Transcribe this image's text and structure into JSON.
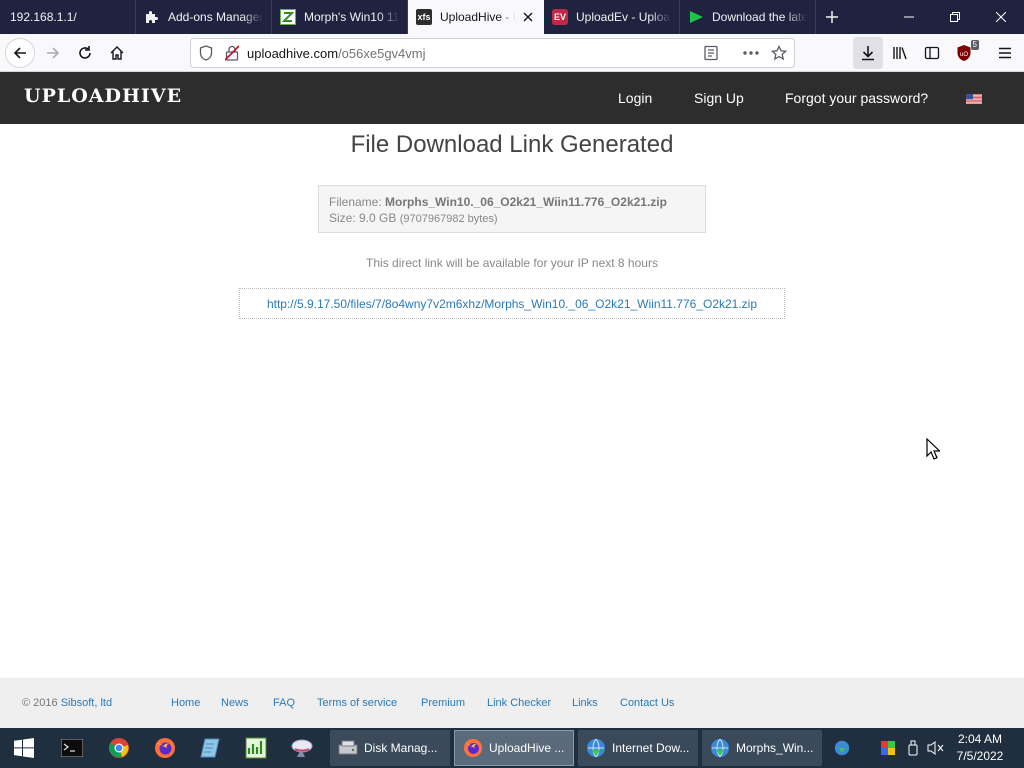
{
  "browser": {
    "tabs": [
      {
        "label": "192.168.1.1/"
      },
      {
        "label": "Add-ons Manager"
      },
      {
        "label": "Morph's Win10 11"
      },
      {
        "label": "UploadHive - Upl",
        "favicon_text": "xfs",
        "active": true
      },
      {
        "label": "UploadEv - Uploa",
        "favicon_text": "EV"
      },
      {
        "label": "Download the late"
      }
    ],
    "url": {
      "host": "uploadhive.com",
      "path": "/o56xe5gv4vmj"
    },
    "extension_badge": "5"
  },
  "site": {
    "logo": "UPLOADHIVE",
    "nav": {
      "login": "Login",
      "signup": "Sign Up",
      "forgot": "Forgot your password?"
    }
  },
  "main": {
    "heading": "File Download Link Generated",
    "file": {
      "filename_label": "Filename:",
      "filename": "Morphs_Win10._06_O2k21_Wiin11.776_O2k21.zip",
      "size_label": "Size:",
      "size": "9.0 GB",
      "bytes": "(9707967982 bytes)"
    },
    "note": "This direct link will be available for your IP next 8 hours",
    "download_link": "http://5.9.17.50/files/7/8o4wny7v2m6xhz/Morphs_Win10._06_O2k21_Wiin11.776_O2k21.zip"
  },
  "footer": {
    "copyright": "© 2016",
    "org": "Sibsoft, ltd",
    "links": [
      "Home",
      "News",
      "FAQ",
      "Terms of service",
      "Premium",
      "Link Checker",
      "Links",
      "Contact Us"
    ]
  },
  "taskbar": {
    "apps": [
      {
        "label": "Disk Manag..."
      },
      {
        "label": "UploadHive ...",
        "active": true
      },
      {
        "label": "Internet Dow..."
      },
      {
        "label": "Morphs_Win..."
      }
    ],
    "time": "2:04 AM",
    "date": "7/5/2022"
  },
  "colors": {
    "tabstrip_bg": "#202340",
    "site_header_bg": "#2d2d2d",
    "link": "#2a7ab8",
    "taskbar_bg": "#1f2f3f"
  }
}
